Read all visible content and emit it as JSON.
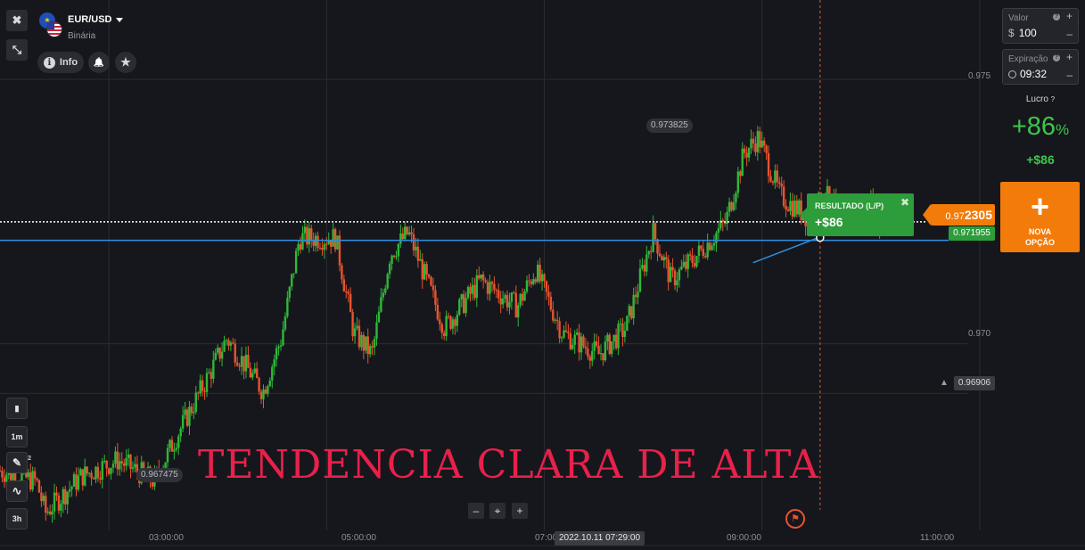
{
  "asset": {
    "name": "EUR/USD",
    "type": "Binária",
    "eu_glyph": "★"
  },
  "toolbar": {
    "close_glyph": "✖",
    "collapse_glyph": "⤡",
    "info_icon_glyph": "i",
    "info_label": "Info",
    "bell_glyph": "🔔",
    "star_glyph": "★"
  },
  "trade_panel": {
    "amount": {
      "label": "Valor",
      "currency_symbol": "$",
      "value": "100",
      "q": "?",
      "plus": "+",
      "minus": "–"
    },
    "expiration": {
      "label": "Expiração",
      "value": "09:32",
      "q": "?",
      "plus": "+",
      "minus": "–"
    },
    "profit": {
      "label": "Lucro",
      "percent": "+86",
      "percent_sign": "%",
      "amount": "+$86",
      "q": "?"
    },
    "new_option": {
      "plus_glyph": "+",
      "line1": "NOVA",
      "line2": "OPÇÃO"
    }
  },
  "result_popup": {
    "title": "RESULTADO (L/P)",
    "value": "+$86",
    "close_glyph": "✖"
  },
  "price": {
    "current_prefix": "0.97",
    "current_suffix": "2305",
    "line_price": "0.971955",
    "alert_price": "0.96906",
    "high_label": "0.973825",
    "low_label": "0.967475"
  },
  "y_axis": {
    "labels": [
      "0.975",
      "0.970"
    ]
  },
  "x_axis": {
    "labels": [
      "03:00:00",
      "05:00:00",
      "07:00",
      "09:00:00",
      "11:00:00"
    ],
    "cursor_date": "2022.10.11 07:29:00"
  },
  "left_tools": {
    "candle_glyph": "▮",
    "timeframe": "1m",
    "draw_glyph": "✎",
    "draw_badge": "2",
    "indicator_glyph": "∿",
    "period": "3h"
  },
  "zoom": {
    "minus": "–",
    "center": "⌖",
    "plus": "+"
  },
  "flag_glyph": "⚑",
  "overlay": {
    "text": "TENDENCIA CLARA DE ALTA"
  },
  "colors": {
    "up": "#2eb83a",
    "down": "#e8532e",
    "accent": "#f27b0a",
    "line": "#2d8fe0",
    "overlay": "#e8214a",
    "grid": "#2a2c33"
  },
  "chart_data": {
    "type": "candlestick",
    "title": "",
    "symbol": "EUR/USD",
    "timeframe": "1m",
    "ylim": [
      0.9661,
      0.9765
    ],
    "yticks": [
      0.975,
      0.97
    ],
    "x_range": [
      "02:00",
      "11:30"
    ],
    "xticks": [
      "03:00",
      "05:00",
      "07:00",
      "09:00",
      "11:00"
    ],
    "path": [
      [
        "02:00",
        0.9676
      ],
      [
        "02:20",
        0.9674
      ],
      [
        "02:25",
        0.9668
      ],
      [
        "02:45",
        0.9675
      ],
      [
        "03:05",
        0.9678
      ],
      [
        "03:25",
        0.9674
      ],
      [
        "03:35",
        0.9681
      ],
      [
        "03:55",
        0.9694
      ],
      [
        "04:05",
        0.9701
      ],
      [
        "04:25",
        0.9691
      ],
      [
        "04:35",
        0.9701
      ],
      [
        "04:45",
        0.972
      ],
      [
        "05:05",
        0.972
      ],
      [
        "05:15",
        0.9702
      ],
      [
        "05:25",
        0.9698
      ],
      [
        "05:35",
        0.9717
      ],
      [
        "05:45",
        0.9721
      ],
      [
        "06:05",
        0.9703
      ],
      [
        "06:25",
        0.9712
      ],
      [
        "06:45",
        0.9707
      ],
      [
        "06:55",
        0.9714
      ],
      [
        "07:10",
        0.9702
      ],
      [
        "07:30",
        0.9698
      ],
      [
        "07:45",
        0.9703
      ],
      [
        "08:00",
        0.9721
      ],
      [
        "08:10",
        0.9712
      ],
      [
        "08:25",
        0.9717
      ],
      [
        "08:40",
        0.9723
      ],
      [
        "08:50",
        0.9736
      ],
      [
        "08:58",
        0.9739
      ],
      [
        "09:10",
        0.9728
      ],
      [
        "09:25",
        0.9724
      ],
      [
        "09:35",
        0.9728
      ],
      [
        "09:50",
        0.9722
      ],
      [
        "10:00",
        0.9726
      ],
      [
        "10:05",
        0.97228
      ]
    ],
    "current_price": 0.972305,
    "horizontal_line": 0.971955,
    "alert_level": 0.96906,
    "high": 0.973825,
    "low": 0.967475,
    "expiration_time": "09:32",
    "trend_line": [
      [
        "09:00",
        0.9716
      ],
      [
        "09:32",
        0.97203
      ]
    ]
  }
}
